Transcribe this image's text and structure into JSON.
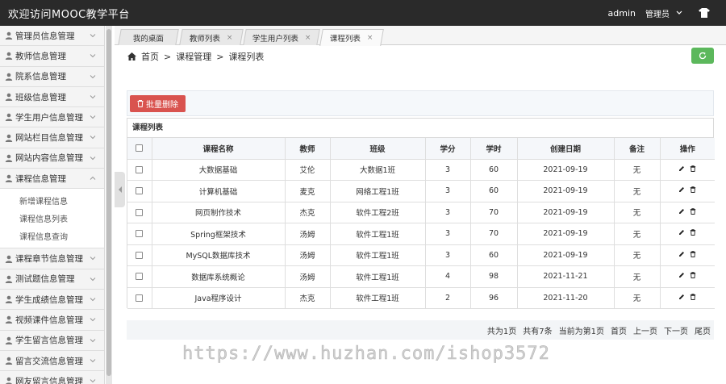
{
  "app": {
    "title": "欢迎访问MOOC教学平台",
    "user": "admin",
    "role": "管理员",
    "shirt_icon": "tshirt-icon"
  },
  "sidebar": {
    "items": [
      {
        "label": "管理员信息管理"
      },
      {
        "label": "教师信息管理"
      },
      {
        "label": "院系信息管理"
      },
      {
        "label": "班级信息管理"
      },
      {
        "label": "学生用户信息管理"
      },
      {
        "label": "网站栏目信息管理"
      },
      {
        "label": "网站内容信息管理"
      },
      {
        "label": "课程信息管理",
        "expanded": true,
        "children": [
          "新增课程信息",
          "课程信息列表",
          "课程信息查询"
        ]
      },
      {
        "label": "课程章节信息管理"
      },
      {
        "label": "测试题信息管理"
      },
      {
        "label": "学生成绩信息管理"
      },
      {
        "label": "视频课件信息管理"
      },
      {
        "label": "学生留言信息管理"
      },
      {
        "label": "留言交流信息管理"
      },
      {
        "label": "网友留言信息管理"
      }
    ]
  },
  "tabs": [
    {
      "label": "我的桌面",
      "closable": false
    },
    {
      "label": "教师列表",
      "closable": true
    },
    {
      "label": "学生用户列表",
      "closable": true
    },
    {
      "label": "课程列表",
      "closable": true,
      "active": true
    }
  ],
  "breadcrumb": {
    "home": "首页",
    "sep": ">",
    "level1": "课程管理",
    "level2": "课程列表"
  },
  "toolbar": {
    "batch_delete": "批量删除"
  },
  "table": {
    "title": "课程列表",
    "headers": [
      "课程名称",
      "教师",
      "班级",
      "学分",
      "学时",
      "创建日期",
      "备注",
      "操作"
    ],
    "rows": [
      [
        "大数据基础",
        "艾伦",
        "大数据1班",
        "3",
        "60",
        "2021-09-19",
        "无"
      ],
      [
        "计算机基础",
        "麦克",
        "网络工程1班",
        "3",
        "60",
        "2021-09-19",
        "无"
      ],
      [
        "网页制作技术",
        "杰克",
        "软件工程2班",
        "3",
        "70",
        "2021-09-19",
        "无"
      ],
      [
        "Spring框架技术",
        "汤姆",
        "软件工程1班",
        "3",
        "70",
        "2021-09-19",
        "无"
      ],
      [
        "MySQL数据库技术",
        "汤姆",
        "软件工程1班",
        "3",
        "60",
        "2021-09-19",
        "无"
      ],
      [
        "数据库系统概论",
        "汤姆",
        "软件工程1班",
        "4",
        "98",
        "2021-11-21",
        "无"
      ],
      [
        "Java程序设计",
        "杰克",
        "软件工程1班",
        "2",
        "96",
        "2021-11-20",
        "无"
      ]
    ]
  },
  "pager": {
    "total_pages": "共为1页",
    "total_rows": "共有7条",
    "current": "当前为第1页",
    "first": "首页",
    "prev": "上一页",
    "next": "下一页",
    "last": "尾页"
  },
  "watermark": "https://www.huzhan.com/ishop3572",
  "colors": {
    "topbar": "#2a2a2a",
    "danger": "#d9534f",
    "success": "#5cb85c"
  }
}
